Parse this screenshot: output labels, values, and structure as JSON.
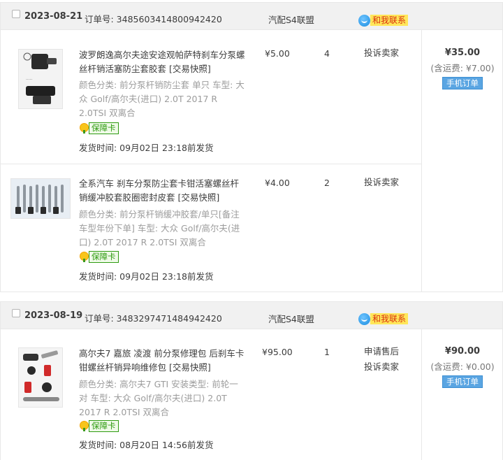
{
  "orders": [
    {
      "date": "2023-08-21",
      "order_no": "订单号: 3485603414800942420",
      "shop": "汽配S4联盟",
      "contact": "和我联系",
      "items": [
        {
          "title": "波罗朗逸高尔夫途安途观帕萨特刹车分泵螺丝杆销活塞防尘套胶套",
          "snapshot": "[交易快照]",
          "sku": "颜色分类: 前分泵杆销防尘套 单只  车型: 大众 Golf/高尔夫(进口) 2.0T 2017 R 2.0TSI 双离合",
          "badge": "保障卡",
          "ship_time": "发货时间: 09月02日 23:18前发货",
          "price": "¥5.00",
          "qty": "4",
          "services": [
            "投诉卖家"
          ],
          "thumb_icon": "brake-pin-boot-image"
        },
        {
          "title": "全系汽车 刹车分泵防尘套卡钳活塞螺丝杆销缓冲胶套胶圈密封皮套",
          "snapshot": "[交易快照]",
          "sku": "颜色分类: 前分泵杆销缓冲胶套/单只[备注车型年份下单]  车型: 大众 Golf/高尔夫(进口) 2.0T 2017 R 2.0TSI 双离合",
          "badge": "保障卡",
          "ship_time": "发货时间: 09月02日 23:18前发货",
          "price": "¥4.00",
          "qty": "2",
          "services": [
            "投诉卖家"
          ],
          "thumb_icon": "caliper-pins-image"
        }
      ],
      "total": "¥35.00",
      "shipping_fee": "(含运费: ¥7.00)",
      "mobile_order": "手机订单"
    },
    {
      "date": "2023-08-19",
      "order_no": "订单号: 3483297471484942420",
      "shop": "汽配S4联盟",
      "contact": "和我联系",
      "items": [
        {
          "title": "高尔夫7 嘉旅 凌渡 前分泵修理包 后刹车卡钳螺丝杆销异响维修包",
          "snapshot": "[交易快照]",
          "sku": "颜色分类: 高尔夫7 GTI  安装类型: 前轮一对  车型: 大众 Golf/高尔夫(进口) 2.0T 2017 R 2.0TSI 双离合",
          "badge": "保障卡",
          "ship_time": "发货时间: 08月20日 14:56前发货",
          "price": "¥95.00",
          "qty": "1",
          "services": [
            "申请售后",
            "投诉卖家"
          ],
          "thumb_icon": "repair-kit-image"
        }
      ],
      "total": "¥90.00",
      "shipping_fee": "(含运费: ¥0.00)",
      "mobile_order": "手机订单"
    }
  ]
}
